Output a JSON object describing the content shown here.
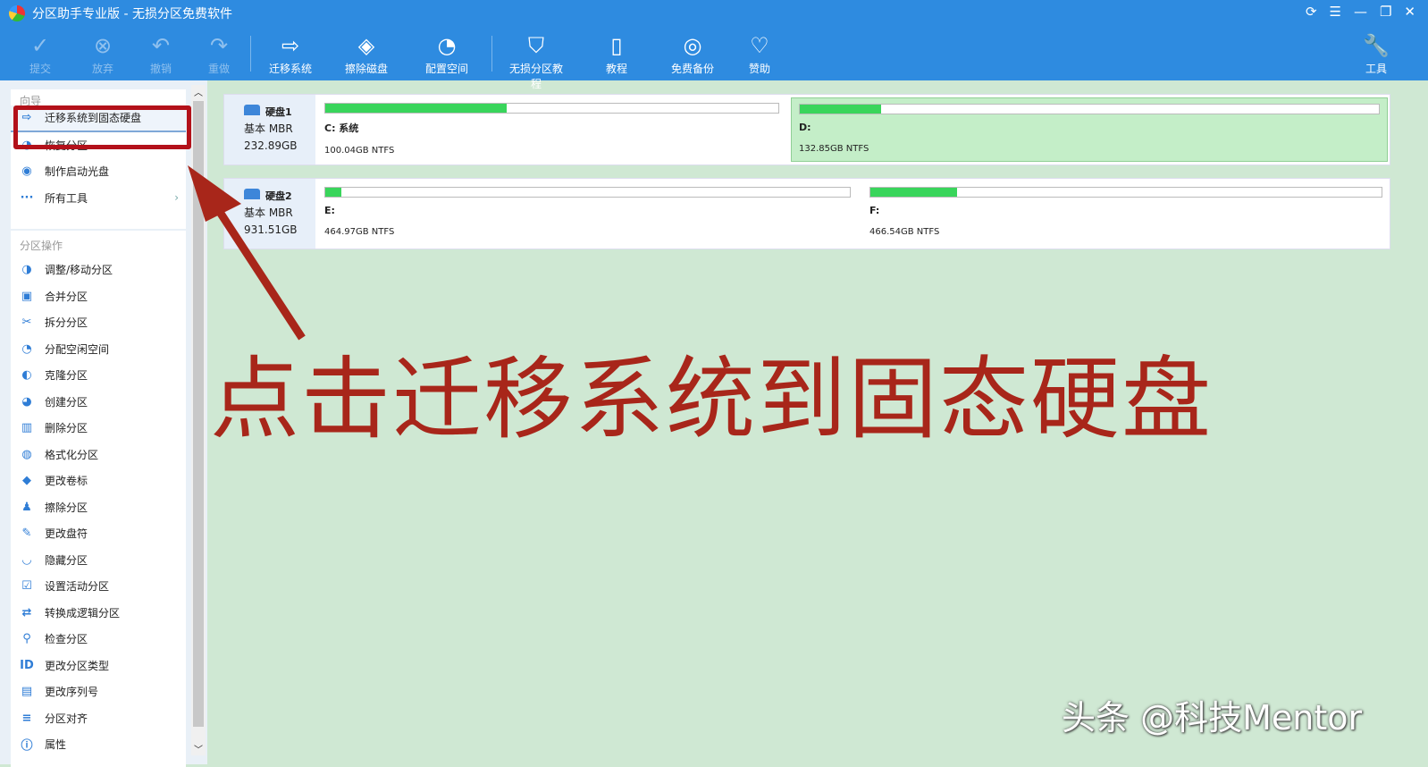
{
  "window": {
    "title": "分区助手专业版 - 无损分区免费软件",
    "controls": [
      "⟳",
      "☰",
      "—",
      "❐",
      "✕"
    ]
  },
  "toolbar": {
    "items": [
      {
        "label": "提交",
        "icon": "✓",
        "disabled": true
      },
      {
        "label": "放弃",
        "icon": "⊗",
        "disabled": true
      },
      {
        "label": "撤销",
        "icon": "↶",
        "disabled": true
      },
      {
        "label": "重做",
        "icon": "↷",
        "disabled": true
      },
      {
        "label": "迁移系统",
        "icon": "⇨"
      },
      {
        "label": "擦除磁盘",
        "icon": "◈"
      },
      {
        "label": "配置空间",
        "icon": "◔"
      },
      {
        "label": "无损分区教程",
        "icon": "⛉"
      },
      {
        "label": "教程",
        "icon": "▯"
      },
      {
        "label": "免费备份",
        "icon": "◎"
      },
      {
        "label": "赞助",
        "icon": "♡"
      }
    ],
    "tools_label": "工具",
    "tools_icon": "🔧"
  },
  "sidebar": {
    "wizard_title": "向导",
    "wizard": [
      {
        "label": "迁移系统到固态硬盘",
        "icon": "⇨"
      },
      {
        "label": "恢复分区",
        "icon": "◕"
      },
      {
        "label": "制作启动光盘",
        "icon": "◉"
      },
      {
        "label": "所有工具",
        "icon": "···"
      }
    ],
    "ops_title": "分区操作",
    "ops": [
      {
        "label": "调整/移动分区",
        "icon": "◑"
      },
      {
        "label": "合并分区",
        "icon": "▣"
      },
      {
        "label": "拆分分区",
        "icon": "✂"
      },
      {
        "label": "分配空闲空间",
        "icon": "◔"
      },
      {
        "label": "克隆分区",
        "icon": "◐"
      },
      {
        "label": "创建分区",
        "icon": "◕"
      },
      {
        "label": "删除分区",
        "icon": "▥"
      },
      {
        "label": "格式化分区",
        "icon": "◍"
      },
      {
        "label": "更改卷标",
        "icon": "◆"
      },
      {
        "label": "擦除分区",
        "icon": "♟"
      },
      {
        "label": "更改盘符",
        "icon": "✎"
      },
      {
        "label": "隐藏分区",
        "icon": "◡"
      },
      {
        "label": "设置活动分区",
        "icon": "☑"
      },
      {
        "label": "转换成逻辑分区",
        "icon": "⇄"
      },
      {
        "label": "检查分区",
        "icon": "⚲"
      },
      {
        "label": "更改分区类型",
        "icon": "ID"
      },
      {
        "label": "更改序列号",
        "icon": "▤"
      },
      {
        "label": "分区对齐",
        "icon": "≡"
      },
      {
        "label": "属性",
        "icon": "ⓘ"
      }
    ]
  },
  "disks": [
    {
      "name": "硬盘1",
      "type": "基本 MBR",
      "size": "232.89GB",
      "parts": [
        {
          "label": "C: 系统",
          "info": "100.04GB NTFS",
          "used": 0.4
        },
        {
          "label": "D:",
          "info": "132.85GB NTFS",
          "used": 0.14,
          "selected": true
        }
      ]
    },
    {
      "name": "硬盘2",
      "type": "基本 MBR",
      "size": "931.51GB",
      "parts": [
        {
          "label": "E:",
          "info": "464.97GB NTFS",
          "used": 0.03
        },
        {
          "label": "F:",
          "info": "466.54GB NTFS",
          "used": 0.17
        }
      ]
    }
  ],
  "annotation": "点击迁移系统到固态硬盘",
  "watermark": "头条 @科技Mentor"
}
